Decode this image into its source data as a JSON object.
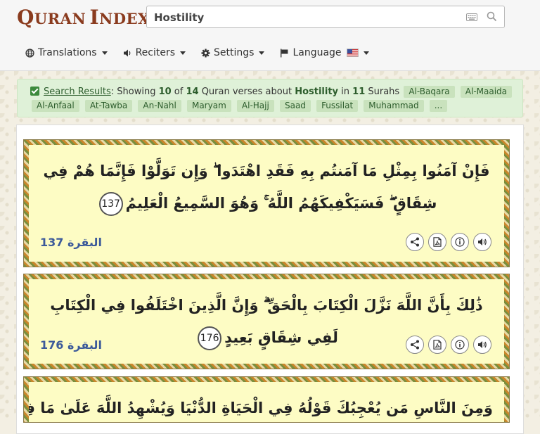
{
  "header": {
    "logo": {
      "big1": "Q",
      "rest1": "URAN",
      "big2": "I",
      "rest2": "NDEX"
    },
    "search": {
      "value": "Hostility"
    },
    "nav": [
      {
        "label": "Translations",
        "icon": "globe-icon"
      },
      {
        "label": "Reciters",
        "icon": "speaker-icon"
      },
      {
        "label": "Settings",
        "icon": "gear-icon"
      },
      {
        "label": "Language",
        "icon": "flag-icon"
      }
    ]
  },
  "banner": {
    "link": "Search Results",
    "t1": ": Showing ",
    "shown": "10",
    "t2": " of ",
    "total": "14",
    "t3": " Quran verses about ",
    "topic": "Hostility",
    "t4": " in ",
    "surah_count": "11",
    "t5": " Surahs",
    "surahs": [
      "Al-Baqara",
      "Al-Maaida",
      "Al-Anfaal",
      "At-Tawba",
      "An-Nahl",
      "Maryam",
      "Al-Hajj",
      "Saad",
      "Fussilat",
      "Muhammad",
      "..."
    ]
  },
  "verses": [
    {
      "text": "فَإِنْ آمَنُوا بِمِثْلِ مَا آمَنتُم بِهِ فَقَدِ اهْتَدَوا ۖ وَإِن تَوَلَّوْا فَإِنَّمَا هُمْ فِي شِقَاقٍ ۖ فَسَيَكْفِيكَهُمُ اللَّهُ ۚ وَهُوَ السَّمِيعُ الْعَلِيمُ",
      "number": "137",
      "surah": "البقرة",
      "ref_number": "137"
    },
    {
      "text": "ذَٰلِكَ بِأَنَّ اللَّهَ نَزَّلَ الْكِتَابَ بِالْحَقِّ ۗ وَإِنَّ الَّذِينَ اخْتَلَفُوا فِي الْكِتَابِ لَفِي شِقَاقٍ بَعِيدٍ",
      "number": "176",
      "surah": "البقرة",
      "ref_number": "176"
    },
    {
      "text": "وَمِنَ النَّاسِ مَن يُعْجِبُكَ قَوْلُهُ فِي الْحَيَاةِ الدُّنْيَا وَيُشْهِدُ اللَّهَ عَلَىٰ مَا فِي قَلْبِهِ وَهُوَ أَلَدُّ"
    }
  ]
}
